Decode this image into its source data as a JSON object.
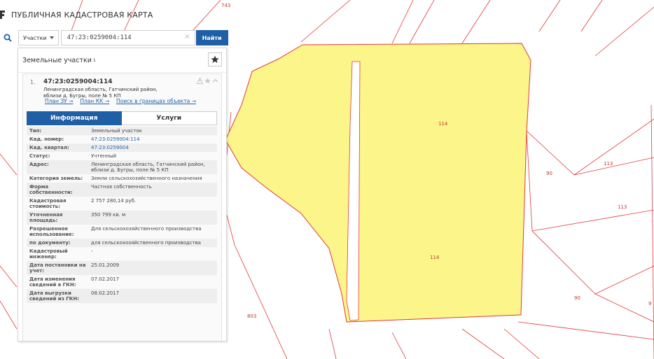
{
  "header": {
    "title": "ПУБЛИЧНАЯ КАДАСТРОВАЯ КАРТА"
  },
  "search": {
    "type_label": "Участки",
    "query": "47:23:0259004:114",
    "find_label": "Найти"
  },
  "panel": {
    "title": "Земельные участки",
    "count": "1",
    "item": {
      "number": "1.",
      "cad_number": "47:23:0259004:114",
      "address_line1": "Ленинградская область, Гатчинский район,",
      "address_line2": "вблизи д. Бугры, поле № 5 КП",
      "links": [
        "План ЗУ →",
        "План КК →",
        "Поиск в границах объекта →"
      ],
      "tabs": [
        "Информация",
        "Услуги"
      ],
      "properties": [
        {
          "label": "Тип:",
          "value": "Земельный участок"
        },
        {
          "label": "Кад. номер:",
          "value": "47:23:0259004:114",
          "link": true
        },
        {
          "label": "Кад. квартал:",
          "value": "47:23:0259004",
          "link": true
        },
        {
          "label": "Статус:",
          "value": "Учтенный"
        },
        {
          "label": "Адрес:",
          "value": "Ленинградская область, Гатчинский район, вблизи д. Бугры, поле № 5 КП"
        },
        {
          "label": "Категория земель:",
          "value": "Земли сельскохозяйственного назначения"
        },
        {
          "label": "Форма собственности:",
          "value": "Частная собственность"
        },
        {
          "label": "Кадастровая стоимость:",
          "value": "2 757 280,14 руб."
        },
        {
          "label": "Уточненная площадь:",
          "value": "350 799 кв. м"
        },
        {
          "label": "Разрешенное использование:",
          "value": "Для сельскохозяйственного производства"
        },
        {
          "label": "по документу:",
          "value": "для сельскохозяйственного производства"
        },
        {
          "label": "Кадастровый инженер:",
          "value": "-"
        },
        {
          "label": "Дата постановки на учет:",
          "value": "25.01.2009"
        },
        {
          "label": "Дата изменения сведений в ГКН:",
          "value": "07.02.2017"
        },
        {
          "label": "Дата выгрузки сведений из ГКН:",
          "value": "08.02.2017"
        }
      ]
    }
  },
  "map": {
    "labels": [
      "743",
      "114",
      "114",
      "113",
      "90",
      "113",
      "90",
      "803",
      "9"
    ],
    "parcel_fill": "#fbf58a",
    "boundary_color": "#e03a3a"
  }
}
